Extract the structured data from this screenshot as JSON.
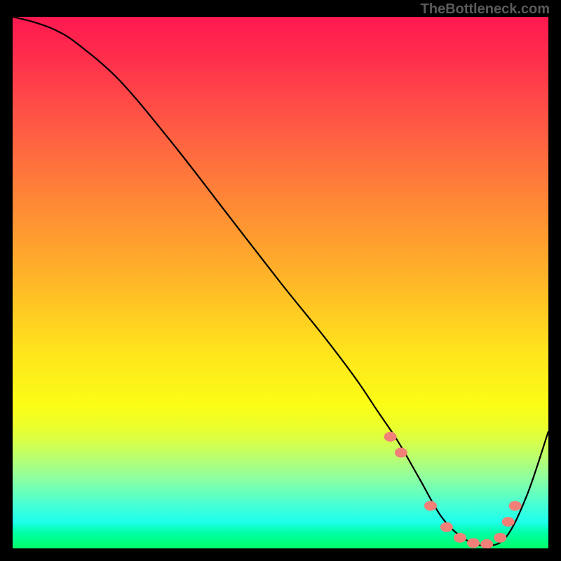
{
  "watermark": "TheBottleneck.com",
  "chart_data": {
    "type": "line",
    "title": "",
    "xlabel": "",
    "ylabel": "",
    "xlim": [
      0,
      100
    ],
    "ylim": [
      0,
      100
    ],
    "grid": false,
    "series": [
      {
        "name": "bottleneck-curve",
        "color": "#000000",
        "x": [
          0,
          4,
          8,
          12,
          20,
          30,
          40,
          50,
          58,
          64,
          68,
          72,
          76,
          80,
          84,
          88,
          92,
          96,
          100
        ],
        "y": [
          100,
          99,
          97.5,
          95,
          88,
          76,
          63,
          50,
          40,
          32,
          26,
          20,
          13,
          6,
          2,
          0.5,
          2,
          10,
          22
        ]
      }
    ],
    "markers": {
      "name": "salmon-dots",
      "color": "#f08078",
      "x": [
        70.5,
        72.5,
        78,
        81,
        83.5,
        86,
        88.5,
        91,
        92.5,
        93.8
      ],
      "y": [
        21,
        18,
        8,
        4,
        2,
        1,
        0.8,
        2,
        5,
        8
      ]
    },
    "gradient_stops": [
      {
        "pos": 0,
        "color": "#ff1850"
      },
      {
        "pos": 50,
        "color": "#ffc524"
      },
      {
        "pos": 75,
        "color": "#f3ff22"
      },
      {
        "pos": 100,
        "color": "#00ff6b"
      }
    ]
  }
}
